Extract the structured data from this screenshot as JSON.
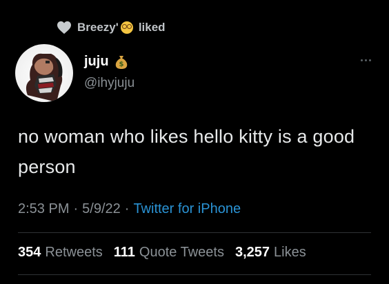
{
  "social_context": {
    "name": "Breezy'",
    "action": "liked",
    "icon": "heart-icon",
    "emoji": "dizzy-face-emoji"
  },
  "author": {
    "display_name": "juju",
    "handle": "@ihyjuju",
    "badge_emoji": "money-bag-emoji"
  },
  "tweet": {
    "text": "no woman who likes hello kitty is a good person"
  },
  "meta": {
    "time": "2:53 PM",
    "separator": "·",
    "date": "5/9/22",
    "source": "Twitter for iPhone",
    "source_color": "#2a93d5"
  },
  "stats": {
    "retweets": {
      "count": "354",
      "label": "Retweets"
    },
    "quote_tweets": {
      "count": "111",
      "label": "Quote Tweets"
    },
    "likes": {
      "count": "3,257",
      "label": "Likes"
    }
  },
  "colors": {
    "background": "#000000",
    "text_primary": "#e7e9ea",
    "text_secondary": "#8b9196",
    "link": "#2a93d5",
    "divider": "#2f3336"
  }
}
